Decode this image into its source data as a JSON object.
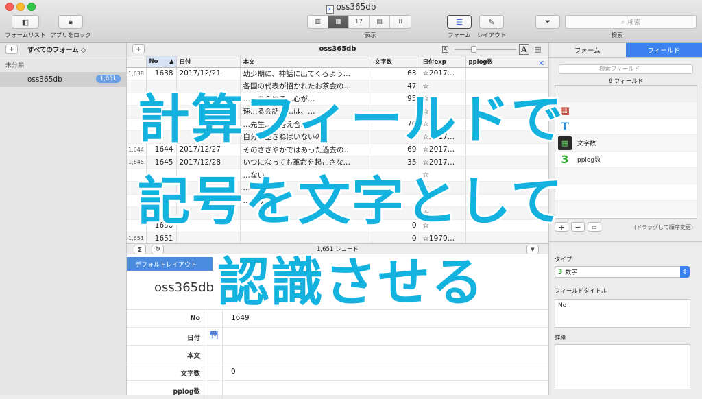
{
  "window": {
    "title": "oss365db"
  },
  "toolbar": {
    "form_list": "フォームリスト",
    "app_lock": "アプリをロック",
    "view_label": "表示",
    "form_label": "フォーム",
    "layout_label": "レイアウト",
    "search_label": "検索",
    "search_placeholder": "検索",
    "view_icons": [
      "columns-icon",
      "table-icon",
      "calendar-icon",
      "map-icon",
      "grid-icon"
    ]
  },
  "sidebar": {
    "add": "+",
    "all_forms": "すべてのフォーム ◇",
    "group": "未分類",
    "items": [
      {
        "label": "oss365db",
        "badge": "1,651"
      }
    ]
  },
  "table": {
    "title": "oss365db",
    "add": "+",
    "font_small": "A",
    "font_large": "A",
    "columns": [
      "",
      "No",
      "日付",
      "本文",
      "文字数",
      "日付exp",
      "pplog数"
    ],
    "rows": [
      [
        "1,638",
        "1638",
        "2017/12/21",
        "幼少期に、神話に出てくるよう…",
        "63",
        "☆2017…",
        ""
      ],
      [
        "",
        "",
        "",
        "各国の代表が招かれたお茶会の…",
        "47",
        "☆",
        ""
      ],
      [
        "",
        "",
        "",
        "…、あらゆる…心が…",
        "95",
        "☆",
        ""
      ],
      [
        "",
        "",
        "",
        "速…る会話が…は、…",
        "",
        "☆",
        ""
      ],
      [
        "",
        "",
        "",
        "…先生…の答え合…",
        "76",
        "☆",
        ""
      ],
      [
        "",
        "",
        "",
        "自分は生きねばいないの…",
        "89",
        "☆2017…",
        ""
      ],
      [
        "1,644",
        "1644",
        "2017/12/27",
        "そのささやかではあった過去の…",
        "69",
        "☆2017…",
        ""
      ],
      [
        "1,645",
        "1645",
        "2017/12/28",
        "いつになっても革命を起こさな…",
        "35",
        "☆2017…",
        ""
      ],
      [
        "",
        "",
        "",
        "…ない…",
        "",
        "☆",
        ""
      ],
      [
        "",
        "",
        "",
        "…",
        "",
        "☆",
        ""
      ],
      [
        "",
        "",
        "",
        "…かけ…",
        "",
        "☆",
        ""
      ],
      [
        "",
        "",
        "",
        "",
        "",
        "☆",
        ""
      ],
      [
        "",
        "1650",
        "",
        "",
        "0",
        "☆",
        ""
      ],
      [
        "1,651",
        "1651",
        "",
        "",
        "0",
        "☆1970…",
        ""
      ]
    ],
    "record_count": "1,651 レコード"
  },
  "form": {
    "layout_tab": "デフォルトレイアウト",
    "title": "oss365db",
    "fields": [
      {
        "label": "No",
        "value": "1649"
      },
      {
        "label": "日付",
        "value": ""
      },
      {
        "label": "本文",
        "value": ""
      },
      {
        "label": "文字数",
        "value": "0"
      },
      {
        "label": "pplog数",
        "value": ""
      }
    ]
  },
  "right_panel": {
    "tabs": [
      "フォーム",
      "フィールド"
    ],
    "search_placeholder": "検索フィールド",
    "field_count": "6 フィールド",
    "fields": [
      {
        "icon": "calendar-icon",
        "label": ""
      },
      {
        "icon": "text-icon",
        "label": ""
      },
      {
        "icon": "calculator-icon",
        "label": "文字数"
      },
      {
        "icon": "number-icon",
        "label": "pplog数"
      }
    ],
    "add": "+",
    "remove": "−",
    "drag_hint": "(ドラッグして順序変更)",
    "type_label": "タイプ",
    "type_value": "数字",
    "field_title_label": "フィールドタイトル",
    "field_title_value": "No",
    "detail_label": "詳細"
  },
  "overlay": {
    "line1": "計算フィールドで",
    "line2": "記号を文字として",
    "line3": "認識させる",
    "color": "#14b2df"
  }
}
